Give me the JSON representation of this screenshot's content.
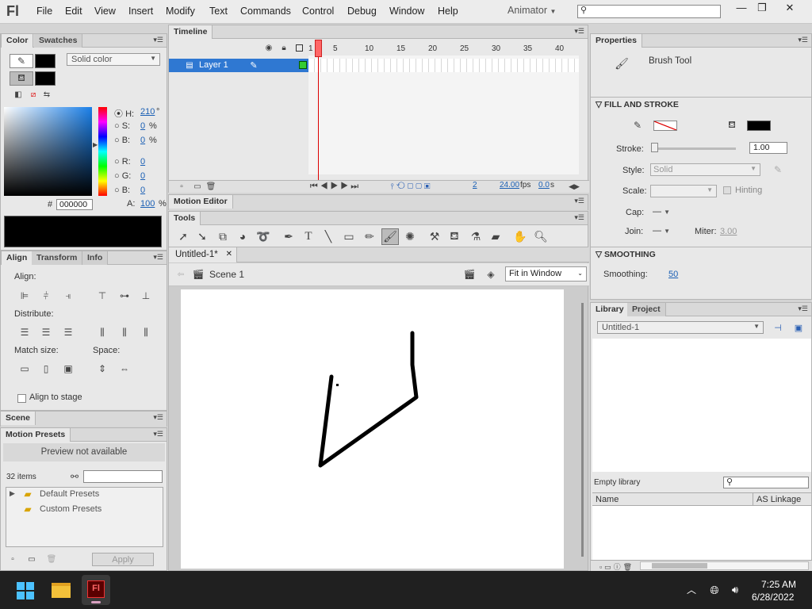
{
  "app": {
    "logo": "Fl",
    "menus": [
      "File",
      "Edit",
      "View",
      "Insert",
      "Modify",
      "Text",
      "Commands",
      "Control",
      "Debug",
      "Window",
      "Help"
    ],
    "workspace": "Animator"
  },
  "color": {
    "tab1": "Color",
    "tab2": "Swatches",
    "type": "Solid color",
    "h_label": "H:",
    "h_val": "210",
    "h_unit": "°",
    "s_label": "S:",
    "s_val": "0",
    "s_unit": "%",
    "b_label": "B:",
    "b_val": "0",
    "b_unit": "%",
    "r_label": "R:",
    "r_val": "0",
    "g_label": "G:",
    "g_val": "0",
    "bb_label": "B:",
    "bb_val": "0",
    "hex_label": "#",
    "hex": "000000",
    "a_label": "A:",
    "a_val": "100",
    "a_unit": "%"
  },
  "align": {
    "tabs": [
      "Align",
      "Transform",
      "Info"
    ],
    "align_label": "Align:",
    "distribute_label": "Distribute:",
    "match_label": "Match size:",
    "space_label": "Space:",
    "stage_label": "Align to stage"
  },
  "scene": {
    "title": "Scene"
  },
  "presets": {
    "title": "Motion Presets",
    "preview": "Preview not available",
    "count": "32 items",
    "folders": [
      "Default Presets",
      "Custom Presets"
    ],
    "apply": "Apply"
  },
  "timeline": {
    "title": "Timeline",
    "layer": "Layer 1",
    "frame_nums": [
      "1",
      "5",
      "10",
      "15",
      "20",
      "25",
      "30",
      "35",
      "40"
    ],
    "frame": "2",
    "fps": "24.00",
    "fps_unit": "fps",
    "time": "0.0",
    "time_unit": "s"
  },
  "motion_editor": {
    "title": "Motion Editor"
  },
  "tools": {
    "title": "Tools"
  },
  "doc": {
    "tab": "Untitled-1*",
    "scene": "Scene 1",
    "zoom": "Fit in Window"
  },
  "properties": {
    "title": "Properties",
    "tool": "Brush Tool",
    "fill_stroke": "FILL AND STROKE",
    "stroke_label": "Stroke:",
    "stroke_val": "1.00",
    "style_label": "Style:",
    "style_val": "Solid",
    "scale_label": "Scale:",
    "hinting": "Hinting",
    "cap_label": "Cap:",
    "cap_val": "—",
    "join_label": "Join:",
    "join_val": "—",
    "miter_label": "Miter:",
    "miter_val": "3.00",
    "smoothing_header": "SMOOTHING",
    "smoothing_label": "Smoothing:",
    "smoothing_val": "50"
  },
  "library": {
    "tabs": [
      "Library",
      "Project"
    ],
    "doc": "Untitled-1",
    "empty": "Empty library",
    "col_name": "Name",
    "col_link": "AS Linkage"
  },
  "taskbar": {
    "time": "7:25 AM",
    "date": "6/28/2022"
  }
}
